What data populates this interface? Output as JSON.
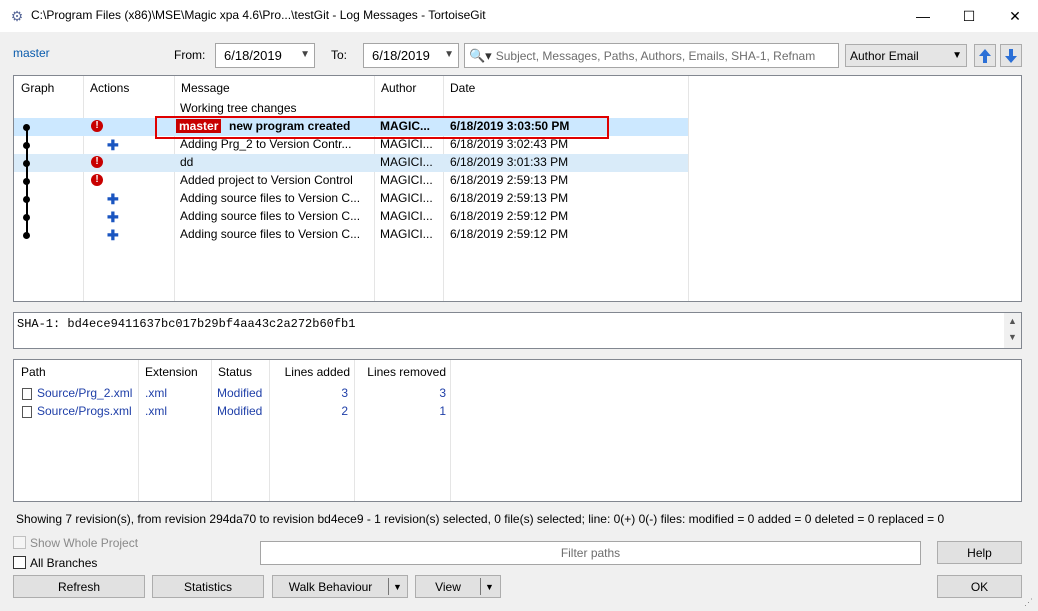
{
  "window": {
    "title": "C:\\Program Files (x86)\\MSE\\Magic xpa 4.6\\Pro...\\testGit - Log Messages - TortoiseGit",
    "minimize": "—",
    "maximize": "☐",
    "close": "✕"
  },
  "filter": {
    "branch": "master",
    "from_label": "From:",
    "from_value": "6/18/2019",
    "to_label": "To:",
    "to_value": "6/18/2019",
    "search_placeholder": "Subject, Messages, Paths, Authors, Emails, SHA-1, Refnam",
    "search_type": "Author Email"
  },
  "log": {
    "columns": [
      "Graph",
      "Actions",
      "Message",
      "Author",
      "Date"
    ],
    "working_tree": "Working tree changes",
    "rows": [
      {
        "ref": "master",
        "message": "new program created",
        "author": "MAGIC...",
        "date": "6/18/2019 3:03:50 PM",
        "icon": "error-icon"
      },
      {
        "ref": "",
        "message": "Adding Prg_2 to Version Contr...",
        "author": "MAGICI...",
        "date": "6/18/2019 3:02:43 PM",
        "icon": "add-file-icon"
      },
      {
        "ref": "",
        "message": "dd",
        "author": "MAGICI...",
        "date": "6/18/2019 3:01:33 PM",
        "icon": "error-icon"
      },
      {
        "ref": "",
        "message": "Added project to Version Control",
        "author": "MAGICI...",
        "date": "6/18/2019 2:59:13 PM",
        "icon": "error-icon"
      },
      {
        "ref": "",
        "message": "Adding source files to Version C...",
        "author": "MAGICI...",
        "date": "6/18/2019 2:59:13 PM",
        "icon": "add-file-icon"
      },
      {
        "ref": "",
        "message": "Adding source files to Version C...",
        "author": "MAGICI...",
        "date": "6/18/2019 2:59:12 PM",
        "icon": "add-file-icon"
      },
      {
        "ref": "",
        "message": "Adding source files to Version C...",
        "author": "MAGICI...",
        "date": "6/18/2019 2:59:12 PM",
        "icon": "add-file-icon"
      }
    ]
  },
  "details": {
    "sha": "SHA-1: bd4ece9411637bc017b29bf4aa43c2a272b60fb1"
  },
  "files": {
    "columns": [
      "Path",
      "Extension",
      "Status",
      "Lines added",
      "Lines removed"
    ],
    "rows": [
      {
        "path": "Source/Prg_2.xml",
        "ext": ".xml",
        "status": "Modified",
        "added": "3",
        "removed": "3"
      },
      {
        "path": "Source/Progs.xml",
        "ext": ".xml",
        "status": "Modified",
        "added": "2",
        "removed": "1"
      }
    ]
  },
  "status_line": "Showing 7 revision(s), from revision 294da70 to revision bd4ece9 - 1 revision(s) selected, 0 file(s) selected; line: 0(+) 0(-) files: modified = 0 added = 0 deleted = 0 replaced = 0",
  "bottom": {
    "show_whole_project": "Show Whole Project",
    "all_branches": "All Branches",
    "filter_placeholder": "Filter paths",
    "help": "Help",
    "refresh": "Refresh",
    "statistics": "Statistics",
    "walk_behaviour": "Walk Behaviour",
    "view": "View",
    "ok": "OK"
  },
  "colors": {
    "selection": "#cce8ff",
    "highlight": "#d9ebf9",
    "accent_red": "#e00000",
    "link_blue": "#0b5cad"
  }
}
